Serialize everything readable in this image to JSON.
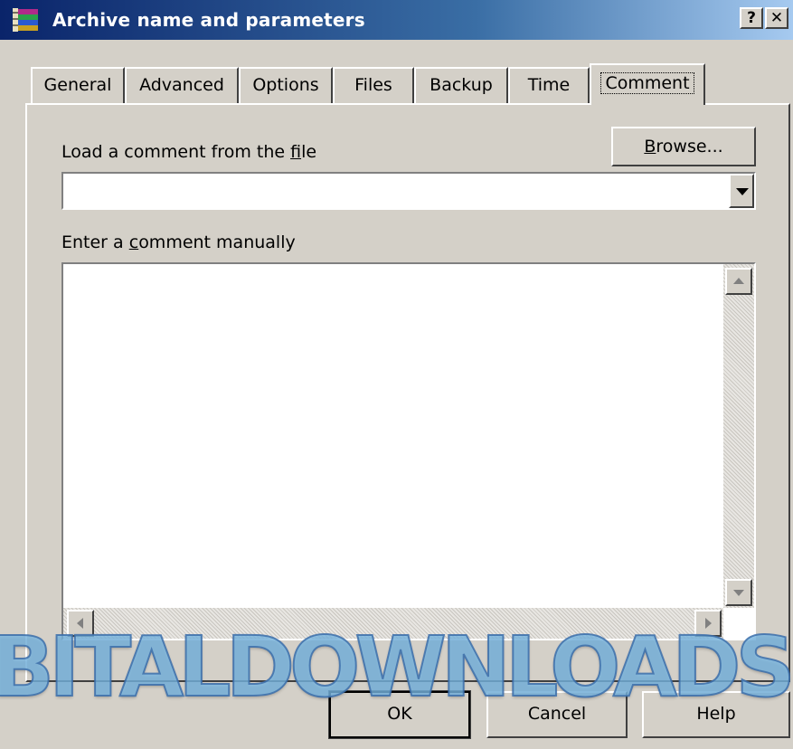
{
  "window": {
    "title": "Archive name and parameters",
    "help_label": "?",
    "close_label": "✕",
    "icon": "winrar-books-icon"
  },
  "tabs": [
    {
      "label": "General",
      "selected": false
    },
    {
      "label": "Advanced",
      "selected": false
    },
    {
      "label": "Options",
      "selected": false
    },
    {
      "label": "Files",
      "selected": false
    },
    {
      "label": "Backup",
      "selected": false
    },
    {
      "label": "Time",
      "selected": false
    },
    {
      "label": "Comment",
      "selected": true
    }
  ],
  "comment_tab": {
    "load_label_pre": "Load a comment from the ",
    "load_label_accel": "f",
    "load_label_post": "ile",
    "browse_accel": "B",
    "browse_rest": "rowse...",
    "file_value": "",
    "manual_label_pre": "Enter a ",
    "manual_label_accel": "c",
    "manual_label_post": "omment manually",
    "comment_value": ""
  },
  "buttons": {
    "ok": "OK",
    "cancel": "Cancel",
    "help": "Help"
  },
  "watermark": "BITALDOWNLOADS",
  "colors": {
    "titlebar_start": "#0a246a",
    "titlebar_end": "#a6caf0",
    "face": "#d4d0c8"
  }
}
